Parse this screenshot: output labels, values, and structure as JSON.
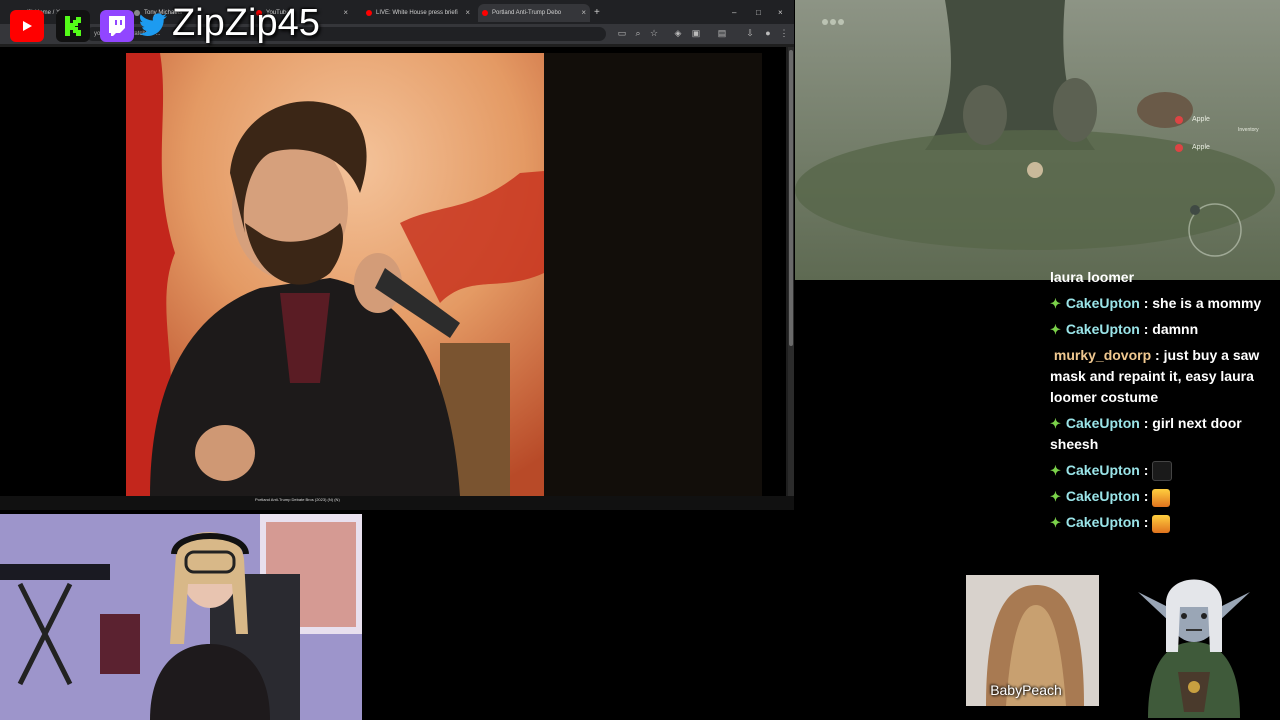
{
  "socials": {
    "handle": "ZipZip45",
    "icons": [
      "youtube-icon",
      "kick-icon",
      "twitch-icon",
      "twitter-icon"
    ],
    "colors": {
      "youtube": "#ff0000",
      "kick": "#53fc18",
      "twitch": "#9146ff",
      "twitter": "#1d9bf0"
    }
  },
  "browser": {
    "tabs": [
      {
        "label": "(3) Home / X",
        "active": false
      },
      {
        "label": "Tony Michaels",
        "active": false
      },
      {
        "label": "YouTube",
        "active": false
      },
      {
        "label": "LIVE: White House press briefi",
        "active": false
      },
      {
        "label": "Portland Anti-Trump Debo",
        "active": true
      }
    ],
    "url": "youtube.com/watch?v=...",
    "video_title": "Portland Anti-Trump Debate Bros (2023) (N) (N)"
  },
  "chat": {
    "partial_line": "laura loomer",
    "messages": [
      {
        "user": "CakeUpton",
        "text": "she is a mommy",
        "badge": true,
        "emote": null
      },
      {
        "user": "CakeUpton",
        "text": "damnn",
        "badge": true,
        "emote": null
      },
      {
        "user": "murky_dovorp",
        "text": "just buy a saw mask and repaint it, easy laura loomer costume",
        "badge": false,
        "emote": null
      },
      {
        "user": "CakeUpton",
        "text": "girl next door sheesh",
        "badge": true,
        "emote": null
      },
      {
        "user": "CakeUpton",
        "text": "",
        "badge": true,
        "emote": "you-tried-emote"
      },
      {
        "user": "CakeUpton",
        "text": "",
        "badge": true,
        "emote": "fire-emote"
      },
      {
        "user": "CakeUpton",
        "text": "",
        "badge": true,
        "emote": "fire-emote"
      }
    ]
  },
  "game": {
    "hud_items": [
      "Apple",
      "Apple"
    ],
    "inventory_label": "Inventory"
  },
  "cams": {
    "secondary_name": "BabyPeach"
  }
}
